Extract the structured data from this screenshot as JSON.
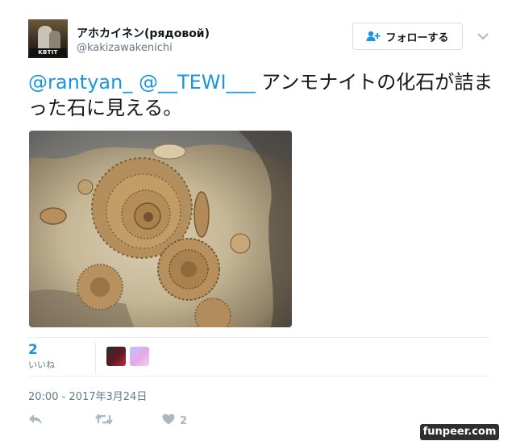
{
  "header": {
    "avatar_caption": "KBTIT",
    "display_name": "アホカイネン(рядовой)",
    "handle": "@kakizawakenichi",
    "follow_label": "フォローする"
  },
  "tweet": {
    "mention1": "@rantyan_",
    "mention2": "@__TEWI___",
    "body": " アンモナイトの化石が詰まった石に見える。"
  },
  "stats": {
    "like_count": "2",
    "like_label": "いいね"
  },
  "timestamp": "20:00 - 2017年3月24日",
  "actions": {
    "like_count": "2"
  },
  "watermark": "funpeer.com",
  "colors": {
    "accent": "#1b95e0",
    "muted": "#657786",
    "action_icon": "#aab8c2"
  }
}
